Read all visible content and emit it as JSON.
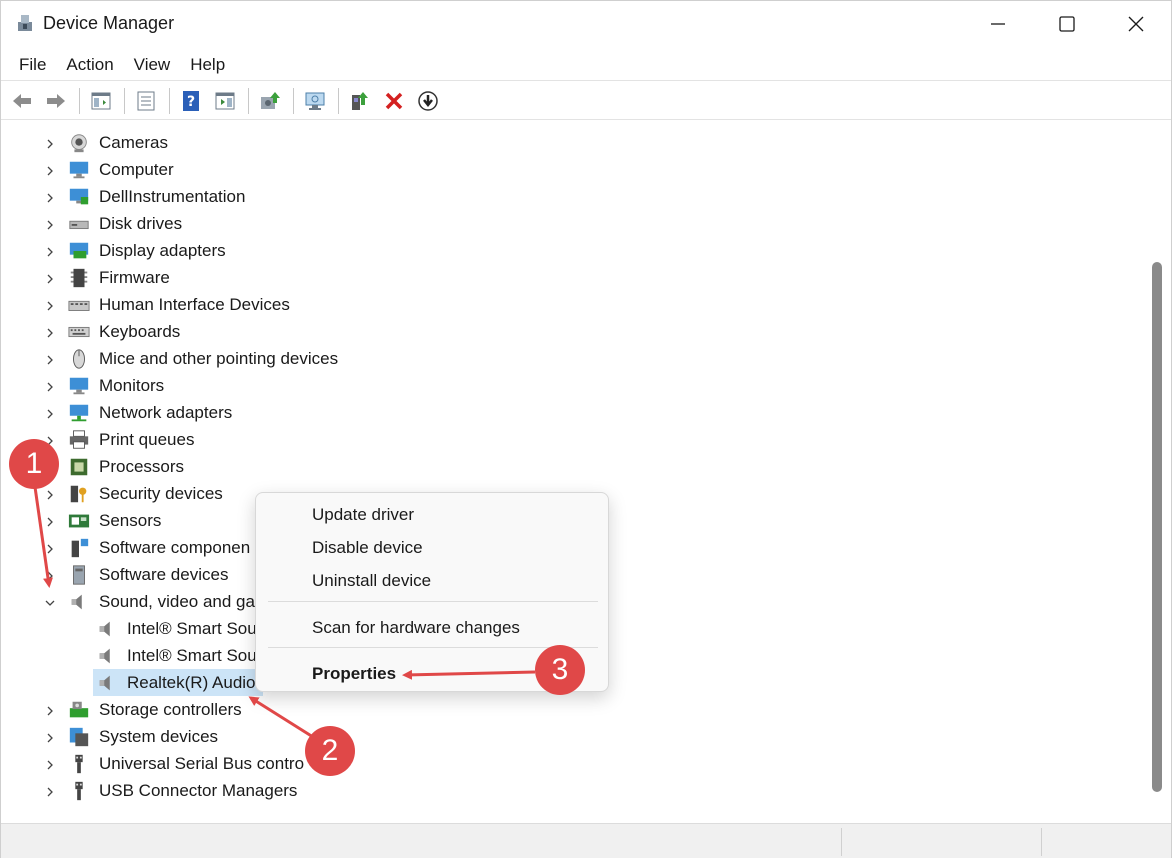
{
  "window": {
    "title": "Device Manager"
  },
  "menu": {
    "items": [
      "File",
      "Action",
      "View",
      "Help"
    ]
  },
  "toolbar": {
    "buttons": [
      "back-icon",
      "forward-icon",
      "show-hide-tree-icon",
      "properties-icon",
      "help-icon",
      "action-pane-icon",
      "update-driver-icon",
      "scan-hardware-icon",
      "add-driver-icon",
      "uninstall-icon",
      "download-icon"
    ]
  },
  "tree": {
    "items": [
      {
        "label": "Cameras",
        "icon": "camera-icon"
      },
      {
        "label": "Computer",
        "icon": "computer-icon"
      },
      {
        "label": "DellInstrumentation",
        "icon": "network-computer-icon"
      },
      {
        "label": "Disk drives",
        "icon": "disk-drive-icon"
      },
      {
        "label": "Display adapters",
        "icon": "display-adapter-icon"
      },
      {
        "label": "Firmware",
        "icon": "firmware-icon"
      },
      {
        "label": "Human Interface Devices",
        "icon": "hid-icon"
      },
      {
        "label": "Keyboards",
        "icon": "keyboard-icon"
      },
      {
        "label": "Mice and other pointing devices",
        "icon": "mouse-icon"
      },
      {
        "label": "Monitors",
        "icon": "monitor-icon"
      },
      {
        "label": "Network adapters",
        "icon": "network-adapter-icon"
      },
      {
        "label": "Print queues",
        "icon": "printer-icon"
      },
      {
        "label": "Processors",
        "icon": "processor-icon"
      },
      {
        "label": "Security devices",
        "icon": "security-device-icon"
      },
      {
        "label": "Sensors",
        "icon": "sensor-icon"
      },
      {
        "label": "Software componen",
        "icon": "software-component-icon"
      },
      {
        "label": "Software devices",
        "icon": "software-device-icon"
      },
      {
        "label": "Sound, video and ga",
        "icon": "speaker-icon",
        "expanded": true
      },
      {
        "label": "Intel® Smart Sou",
        "icon": "speaker-icon",
        "child": true
      },
      {
        "label": "Intel® Smart Sou",
        "icon": "speaker-icon",
        "child": true
      },
      {
        "label": "Realtek(R) Audio",
        "icon": "speaker-icon",
        "child": true,
        "selected": true
      },
      {
        "label": "Storage controllers",
        "icon": "storage-controller-icon"
      },
      {
        "label": "System devices",
        "icon": "system-device-icon"
      },
      {
        "label": "Universal Serial Bus contro",
        "icon": "usb-icon"
      },
      {
        "label": "USB Connector Managers",
        "icon": "usb-icon"
      }
    ]
  },
  "context_menu": {
    "update_driver": "Update driver",
    "disable_device": "Disable device",
    "uninstall_device": "Uninstall device",
    "scan_hardware": "Scan for hardware changes",
    "properties": "Properties"
  },
  "annotations": {
    "badge1": "1",
    "badge2": "2",
    "badge3": "3",
    "color": "#e04848"
  }
}
